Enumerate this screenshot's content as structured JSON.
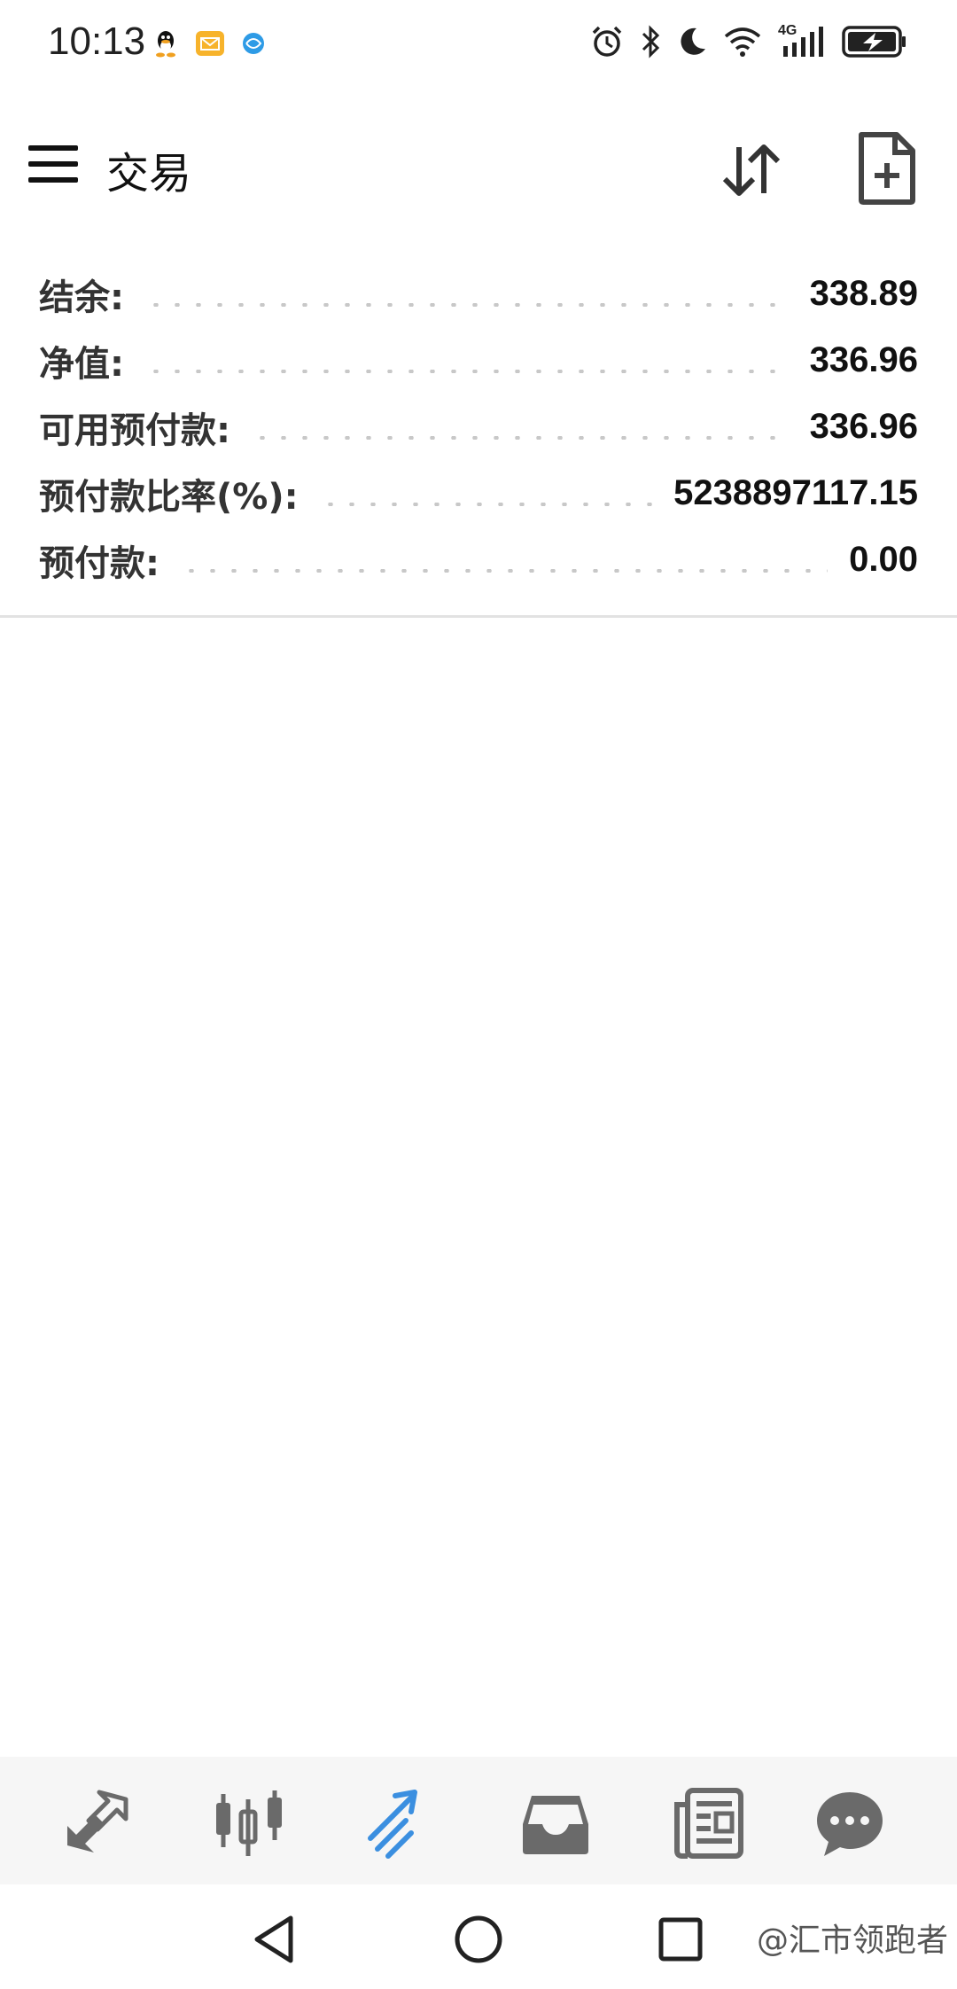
{
  "status_bar": {
    "time": "10:13",
    "left_icons": [
      "qq-icon",
      "mail-icon",
      "browser-icon"
    ],
    "right_icons": [
      "alarm-icon",
      "bluetooth-icon",
      "moon-icon",
      "wifi-icon",
      "signal-4g-icon",
      "battery-charging-icon"
    ],
    "network_label": "4G"
  },
  "app_bar": {
    "title": "交易",
    "actions": [
      "sort-icon",
      "new-order-icon"
    ]
  },
  "summary": {
    "rows": [
      {
        "label": "结余:",
        "value": "338.89"
      },
      {
        "label": "净值:",
        "value": "336.96"
      },
      {
        "label": "可用预付款:",
        "value": "336.96"
      },
      {
        "label": "预付款比率(%):",
        "value": "5238897117.15"
      },
      {
        "label": "预付款:",
        "value": "0.00"
      }
    ]
  },
  "bottom_nav": {
    "items": [
      {
        "icon": "quotes-arrows-icon",
        "active": false
      },
      {
        "icon": "candlestick-chart-icon",
        "active": false
      },
      {
        "icon": "trade-icon",
        "active": true
      },
      {
        "icon": "history-inbox-icon",
        "active": false
      },
      {
        "icon": "news-icon",
        "active": false
      },
      {
        "icon": "chat-icon",
        "active": false
      }
    ],
    "active_color": "#3b8fe0",
    "inactive_color": "#6a6a6a"
  },
  "system_nav": {
    "buttons": [
      "back-icon",
      "home-icon",
      "recents-icon"
    ],
    "watermark": "@汇市领跑者"
  }
}
